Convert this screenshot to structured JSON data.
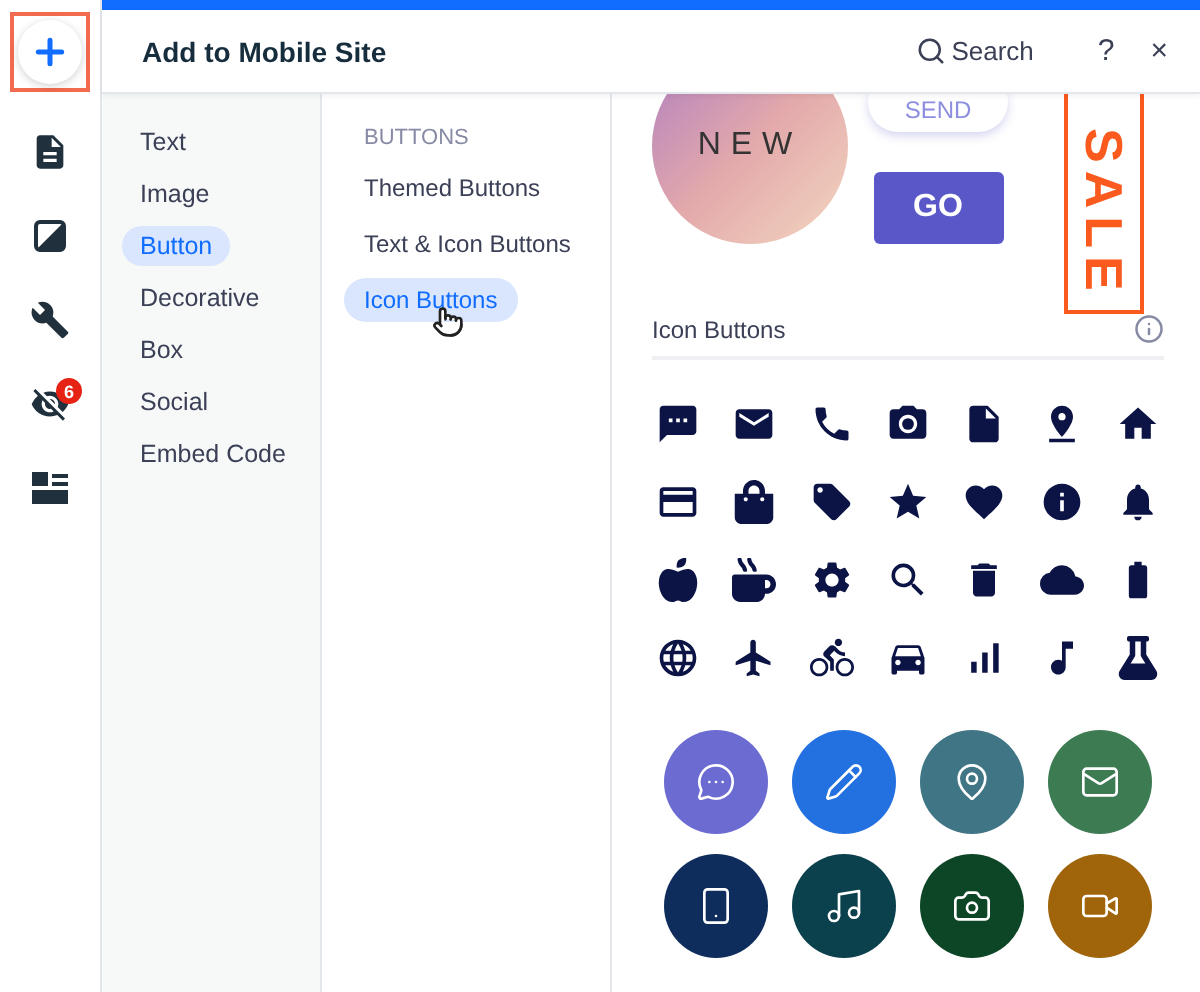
{
  "rail": [
    {
      "kind": "add",
      "selected": true
    },
    {
      "kind": "pages",
      "selected": false
    },
    {
      "kind": "design",
      "selected": false
    },
    {
      "kind": "tools",
      "selected": false
    },
    {
      "kind": "hidden",
      "selected": false,
      "badge": "6"
    },
    {
      "kind": "layout",
      "selected": false
    }
  ],
  "header": {
    "title": "Add to Mobile Site",
    "search": "Search",
    "help": "?",
    "close": "×"
  },
  "categories": [
    {
      "label": "Text",
      "selected": false
    },
    {
      "label": "Image",
      "selected": false
    },
    {
      "label": "Button",
      "selected": true
    },
    {
      "label": "Decorative",
      "selected": false
    },
    {
      "label": "Box",
      "selected": false
    },
    {
      "label": "Social",
      "selected": false
    },
    {
      "label": "Embed Code",
      "selected": false
    }
  ],
  "subcategories": {
    "heading": "BUTTONS",
    "items": [
      {
        "label": "Themed Buttons",
        "selected": false,
        "hovered": false
      },
      {
        "label": "Text & Icon Buttons",
        "selected": false,
        "hovered": false
      },
      {
        "label": "Icon Buttons",
        "selected": true,
        "hovered": true
      }
    ]
  },
  "preview": {
    "new_label": "NEW",
    "send_label": "SEND",
    "go_label": "GO",
    "sale_label": "SALE",
    "section_title": "Icon Buttons",
    "circle_buttons": [
      {
        "kind": "chat",
        "color": "#6c6bd1"
      },
      {
        "kind": "pencil",
        "color": "#2370e0"
      },
      {
        "kind": "pin",
        "color": "#3f7584"
      },
      {
        "kind": "mail",
        "color": "#3d7b53"
      },
      {
        "kind": "phone",
        "color": "#0f2d5c"
      },
      {
        "kind": "music",
        "color": "#0b414c"
      },
      {
        "kind": "camera",
        "color": "#0c4626"
      },
      {
        "kind": "video",
        "color": "#a0640a"
      }
    ]
  }
}
